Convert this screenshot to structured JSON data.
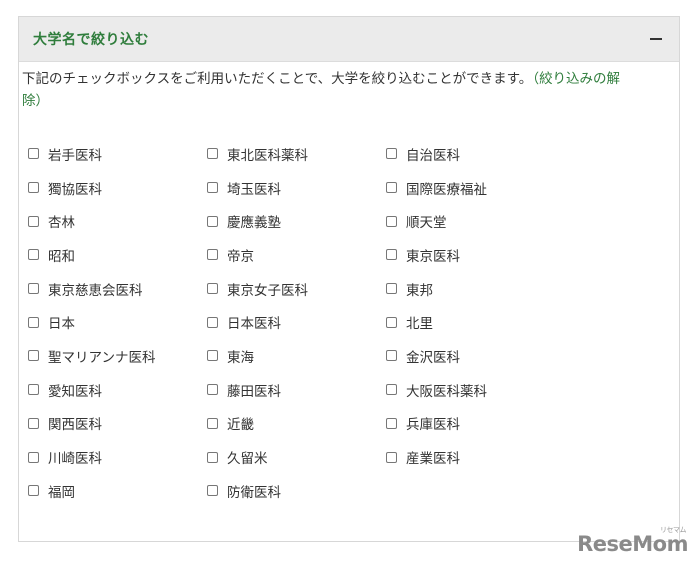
{
  "filter": {
    "title": "大学名で絞り込む",
    "description": "下記のチェックボックスをご利用いただくことで、大学を絞り込むことができます。",
    "clear_link_open": "（",
    "clear_link": "絞り込みの解除",
    "clear_link_close": "）",
    "columns": [
      [
        "岩手医科",
        "獨協医科",
        "杏林",
        "昭和",
        "東京慈恵会医科",
        "日本",
        "聖マリアンナ医科",
        "愛知医科",
        "関西医科",
        "川崎医科",
        "福岡"
      ],
      [
        "東北医科薬科",
        "埼玉医科",
        "慶應義塾",
        "帝京",
        "東京女子医科",
        "日本医科",
        "東海",
        "藤田医科",
        "近畿",
        "久留米",
        "防衛医科"
      ],
      [
        "自治医科",
        "国際医療福祉",
        "順天堂",
        "東京医科",
        "東邦",
        "北里",
        "金沢医科",
        "大阪医科薬科",
        "兵庫医科",
        "産業医科"
      ]
    ]
  },
  "watermark": {
    "text": "ReseMom",
    "small": "リセマム"
  }
}
